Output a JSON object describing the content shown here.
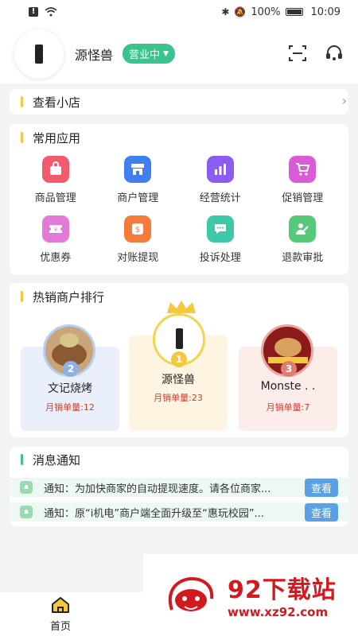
{
  "status_bar": {
    "battery": "100%",
    "time": "10:09"
  },
  "header": {
    "shop_name": "源怪兽",
    "status_label": "营业中"
  },
  "view_shop": {
    "label": "查看小店"
  },
  "apps": {
    "title": "常用应用",
    "items": [
      {
        "label": "商品管理",
        "icon": "shopping-bag-icon",
        "color": "#f25a6e"
      },
      {
        "label": "商户管理",
        "icon": "storefront-icon",
        "color": "#3f7ff0"
      },
      {
        "label": "经营统计",
        "icon": "bar-chart-icon",
        "color": "#8a5cf0"
      },
      {
        "label": "促销管理",
        "icon": "cart-icon",
        "color": "#d95bd6"
      },
      {
        "label": "优惠券",
        "icon": "coupon-icon",
        "color": "#e37ad7"
      },
      {
        "label": "对账提现",
        "icon": "money-bag-icon",
        "color": "#f57b3b"
      },
      {
        "label": "投诉处理",
        "icon": "chat-icon",
        "color": "#3ec7a8"
      },
      {
        "label": "退款审批",
        "icon": "approval-icon",
        "color": "#58c97a"
      }
    ]
  },
  "ranking": {
    "title": "热销商户排行",
    "items": [
      {
        "rank": "2",
        "name": "文记烧烤",
        "sales": "月销单量:12"
      },
      {
        "rank": "1",
        "name": "源怪兽",
        "sales": "月销单量:23"
      },
      {
        "rank": "3",
        "name": "Monste . .",
        "sales": "月销单量:7"
      }
    ]
  },
  "notices": {
    "title": "消息通知",
    "items": [
      {
        "text": "通知：为加快商家的自动提现速度。请各位商家...",
        "button": "查看"
      },
      {
        "text": "通知：原“i机电”商户端全面升级至“惠玩校园”...",
        "button": "查看"
      }
    ]
  },
  "tabbar": {
    "home_label": "首页"
  },
  "watermark": {
    "title": "92下载站",
    "url": "www.xz92.com"
  }
}
